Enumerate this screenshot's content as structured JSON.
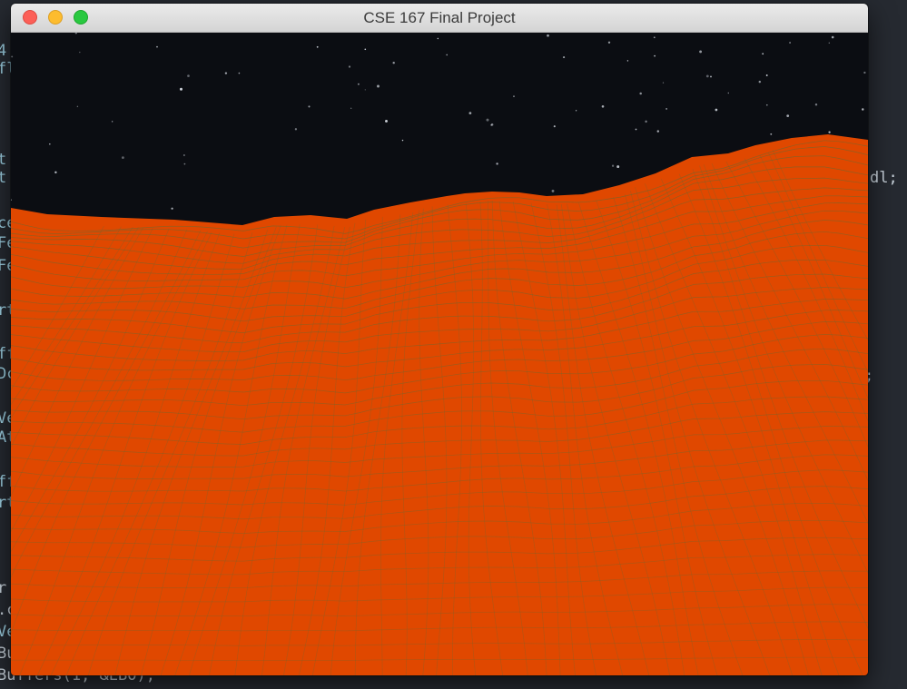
{
  "window": {
    "title": "CSE 167 Final Project",
    "controls": [
      "close",
      "minimize",
      "zoom"
    ]
  },
  "scene": {
    "sky_color": "#0b0d12",
    "star_color": "#cfd4dc",
    "terrain_fill": "#e04800",
    "wireframe_color": "#6b6a30"
  },
  "background_code": {
    "fragments": [
      "4",
      "fl",
      "t",
      "t",
      "dl;",
      "ce",
      "Fe",
      "Fe",
      "rt",
      "ff",
      "Dc",
      ";",
      "Ve",
      "At",
      "ff",
      "rt",
      "r",
      ".c",
      "Ve",
      "Bu",
      "Buffers(1, &EBO);"
    ]
  }
}
